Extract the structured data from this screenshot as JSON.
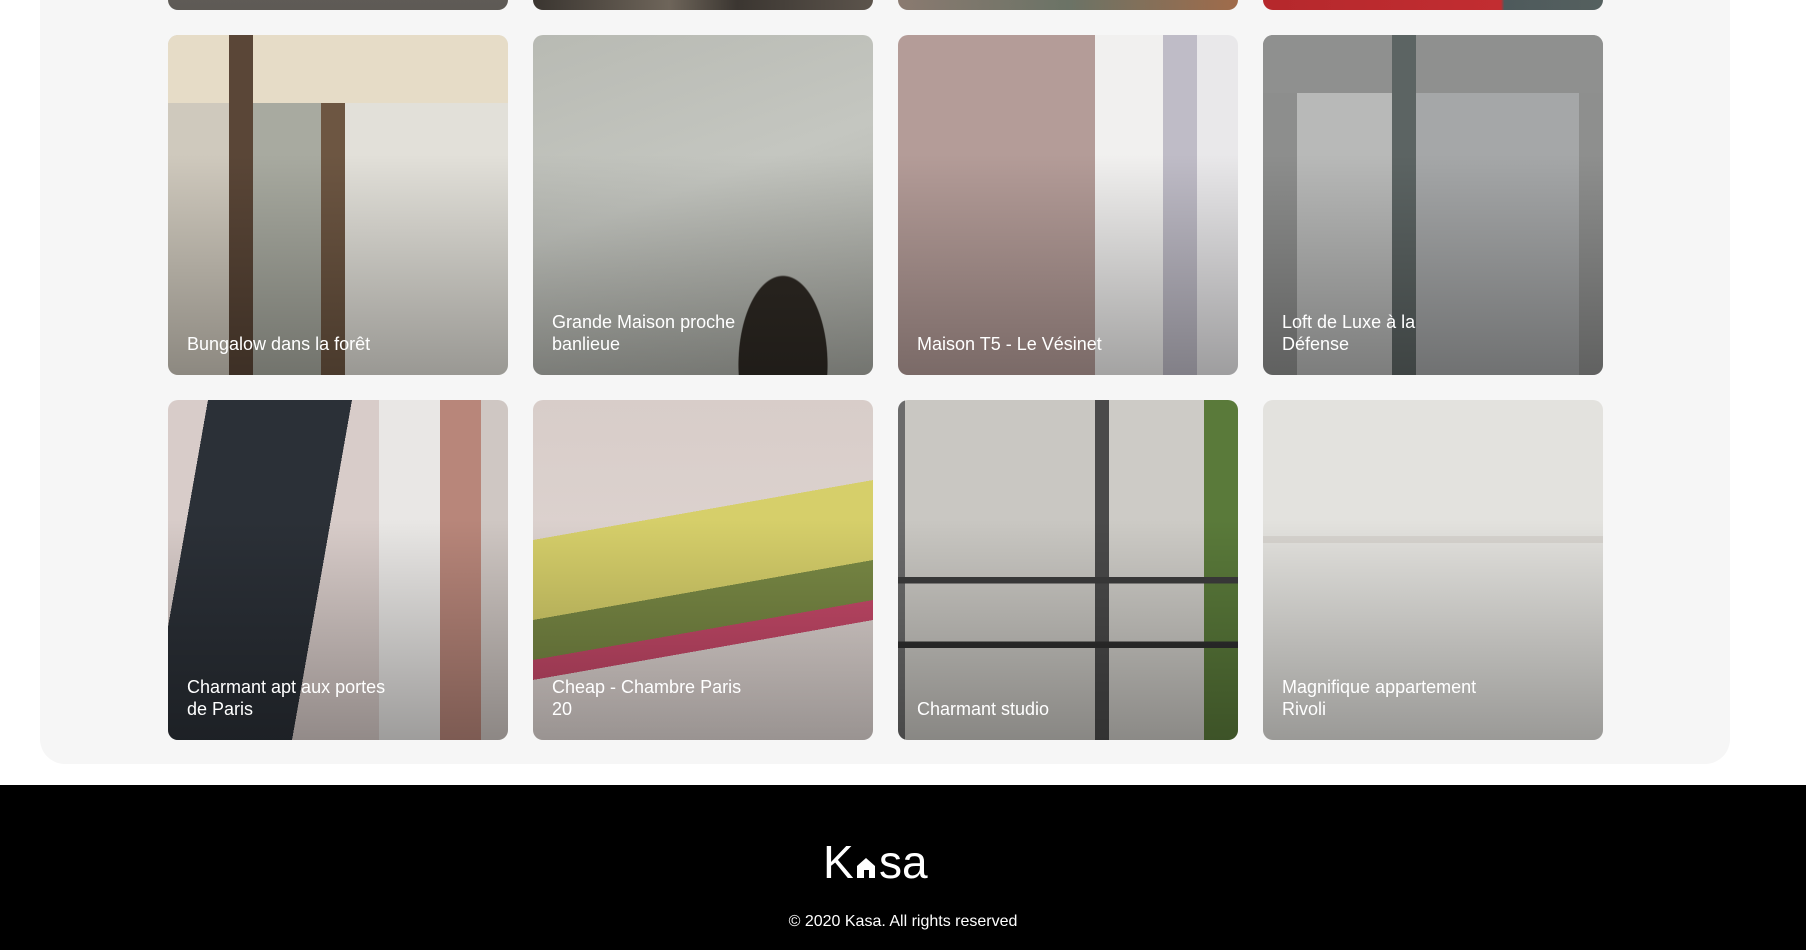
{
  "gallery": {
    "cards": [
      {
        "title": "Bungalow dans la forêt"
      },
      {
        "title": "Grande Maison proche banlieue"
      },
      {
        "title": "Maison T5 - Le Vésinet"
      },
      {
        "title": "Loft de Luxe à la Défense"
      },
      {
        "title": "Charmant apt aux portes de Paris"
      },
      {
        "title": "Cheap - Chambre Paris 20"
      },
      {
        "title": "Charmant studio"
      },
      {
        "title": "Magnifique appartement Rivoli"
      }
    ]
  },
  "footer": {
    "logo_text": "Kasa",
    "copyright": "© 2020 Kasa. All rights reserved"
  },
  "colors": {
    "footer_bg": "#000000",
    "gallery_bg": "#f6f6f6",
    "card_text": "#ffffff"
  }
}
